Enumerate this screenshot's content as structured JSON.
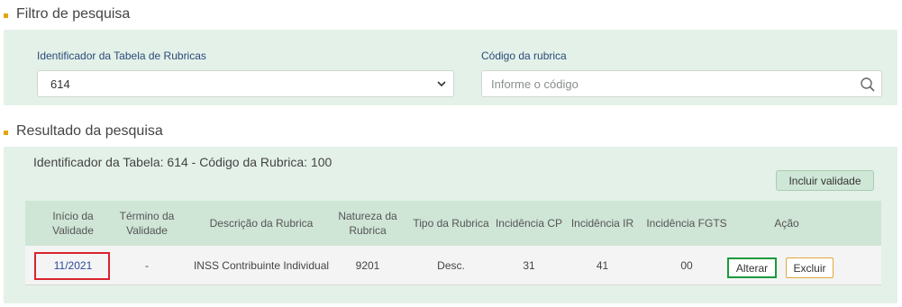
{
  "filter": {
    "title": "Filtro de pesquisa",
    "table_id_label": "Identificador da Tabela de Rubricas",
    "table_id_value": "614",
    "code_label": "Código da rubrica",
    "code_placeholder": "Informe o código"
  },
  "results": {
    "title": "Resultado da pesquisa",
    "header": "Identificador da Tabela: 614 - Código da Rubrica: 100",
    "add_button": "Incluir validade",
    "columns": {
      "inicio": "Início da Validade",
      "termino": "Término da Validade",
      "descricao": "Descrição da Rubrica",
      "natureza": "Natureza da Rubrica",
      "tipo": "Tipo da Rubrica",
      "cp": "Incidência CP",
      "ir": "Incidência IR",
      "fgts": "Incidência FGTS",
      "acao": "Ação"
    },
    "rows": [
      {
        "inicio": "11/2021",
        "termino": "-",
        "descricao": "INSS Contribuinte Individual",
        "natureza": "9201",
        "tipo": "Desc.",
        "cp": "31",
        "ir": "41",
        "fgts": "00",
        "edit_label": "Alterar",
        "delete_label": "Excluir"
      }
    ]
  },
  "colors": {
    "panel_bg": "#e4f1e8",
    "accent_bullet": "#e5a50a",
    "highlight_red": "#d9232e",
    "highlight_green": "#1a9a3a"
  }
}
